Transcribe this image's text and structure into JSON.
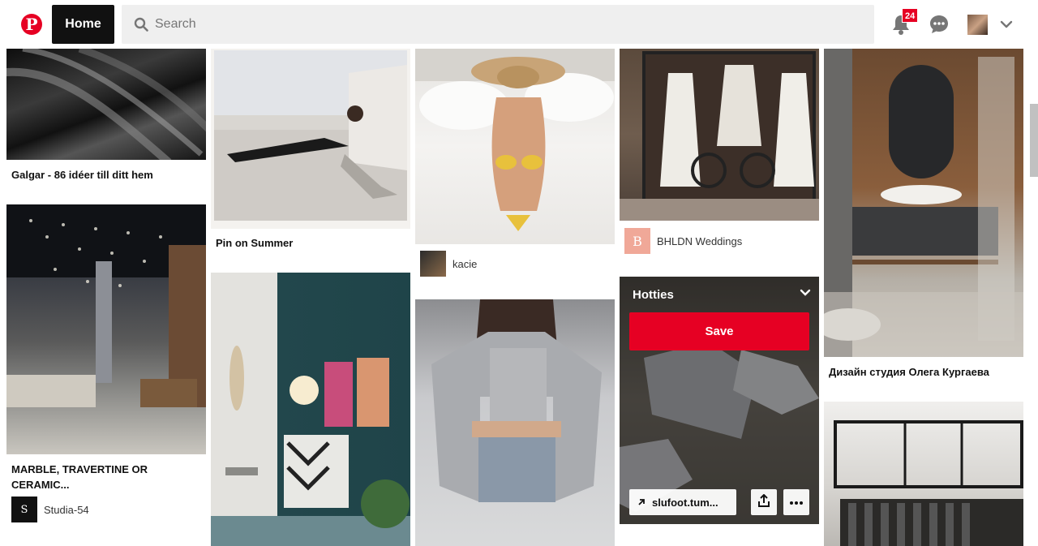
{
  "header": {
    "logo_letter": "P",
    "home_label": "Home",
    "search_placeholder": "Search",
    "notification_count": "24"
  },
  "pins": [
    {
      "title": "Galgar - 86 idéer till ditt hem"
    },
    {
      "title": "MARBLE, TRAVERTINE OR CERAMIC...",
      "attribution": "Studia-54",
      "attribution_icon": "S"
    },
    {
      "title": "Pin on Summer"
    },
    {
      "attribution": "kacie"
    },
    {
      "attribution": "BHLDN Weddings",
      "attribution_icon": "B"
    },
    {
      "board": "Hotties",
      "save_label": "Save",
      "link_label": "slufoot.tum..."
    },
    {
      "title": "Дизайн студия Олега Кургаева"
    }
  ],
  "colors": {
    "brand": "#e60023",
    "home_bg": "#111111",
    "search_bg": "#efefef"
  }
}
